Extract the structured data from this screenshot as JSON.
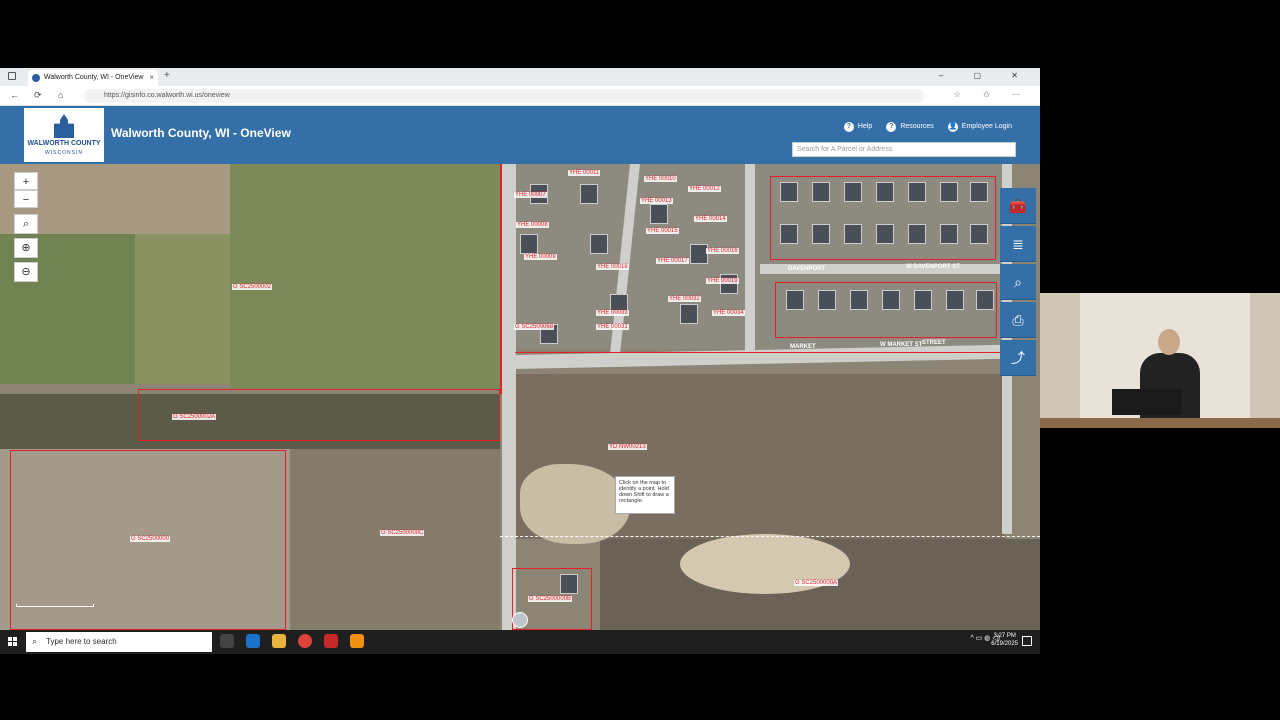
{
  "browser": {
    "tab_title": "Walworth County, WI - OneView",
    "tab_close": "×",
    "new_tab": "+",
    "window_controls": "– ▢ ✕",
    "url": "https://gisinfo.co.walworth.wi.us/oneview",
    "nav": {
      "back": "←",
      "refresh": "⟳",
      "home": "⌂"
    },
    "right_icons": "☆ ✩ ⋯"
  },
  "app": {
    "logo_line1": "WALWORTH COUNTY",
    "logo_line2": "WISCONSIN",
    "title": "Walworth County, WI - OneView",
    "links": [
      {
        "label": "Help",
        "icon": "?"
      },
      {
        "label": "Resources",
        "icon": "?"
      },
      {
        "label": "Employee Login",
        "icon": "👤"
      }
    ],
    "search_placeholder": "Search for A Parcel or Address"
  },
  "map": {
    "controls": {
      "zoom_in": "+",
      "zoom_out": "−",
      "identify": "⌕",
      "zoom_box_in": "⊕",
      "zoom_box_out": "⊖"
    },
    "tooltip": "Click on the map to identify a point. Hold down Shift to draw a rectangle.",
    "parcel_labels": [
      {
        "text": "G SC2500002"
      },
      {
        "text": "G SC2500002A"
      },
      {
        "text": "G SC2500000"
      },
      {
        "text": "G SC2500000C"
      },
      {
        "text": "YD NW00213"
      },
      {
        "text": "G SC2500000A"
      },
      {
        "text": "G SC2500000B"
      },
      {
        "text": "YHE 00011"
      },
      {
        "text": "YHE 00007"
      },
      {
        "text": "YHE 00008"
      },
      {
        "text": "YHE 00009"
      },
      {
        "text": "YHE 00010"
      },
      {
        "text": "YHE 00012"
      },
      {
        "text": "YHE 00013"
      },
      {
        "text": "YHE 00014"
      },
      {
        "text": "YHE 00015"
      },
      {
        "text": "YHE 00016"
      },
      {
        "text": "YHE 00017"
      },
      {
        "text": "YHE 00018"
      },
      {
        "text": "YHE 00019"
      },
      {
        "text": "YHE 00032"
      },
      {
        "text": "YHE 00033"
      },
      {
        "text": "YHE 00034"
      },
      {
        "text": "G SC2500068"
      },
      {
        "text": "YHE 00031"
      }
    ],
    "streets": [
      "MARKET",
      "W MARKET ST",
      "STREET",
      "W DAVENPORT ST",
      "DAVENPORT"
    ],
    "right_tools": [
      {
        "name": "toolbox",
        "glyph": "🧰"
      },
      {
        "name": "layers",
        "glyph": "≣"
      },
      {
        "name": "search",
        "glyph": "⌕"
      },
      {
        "name": "print",
        "glyph": "⎙"
      },
      {
        "name": "share",
        "glyph": "⤴"
      }
    ]
  },
  "taskbar": {
    "search_placeholder": "Type here to search",
    "time": "3:27 PM",
    "date": "6/19/2025",
    "tray": "^ ▭ ◍ ◁)"
  },
  "colors": {
    "header": "#356fa8",
    "parcel_line": "#e4202a"
  }
}
